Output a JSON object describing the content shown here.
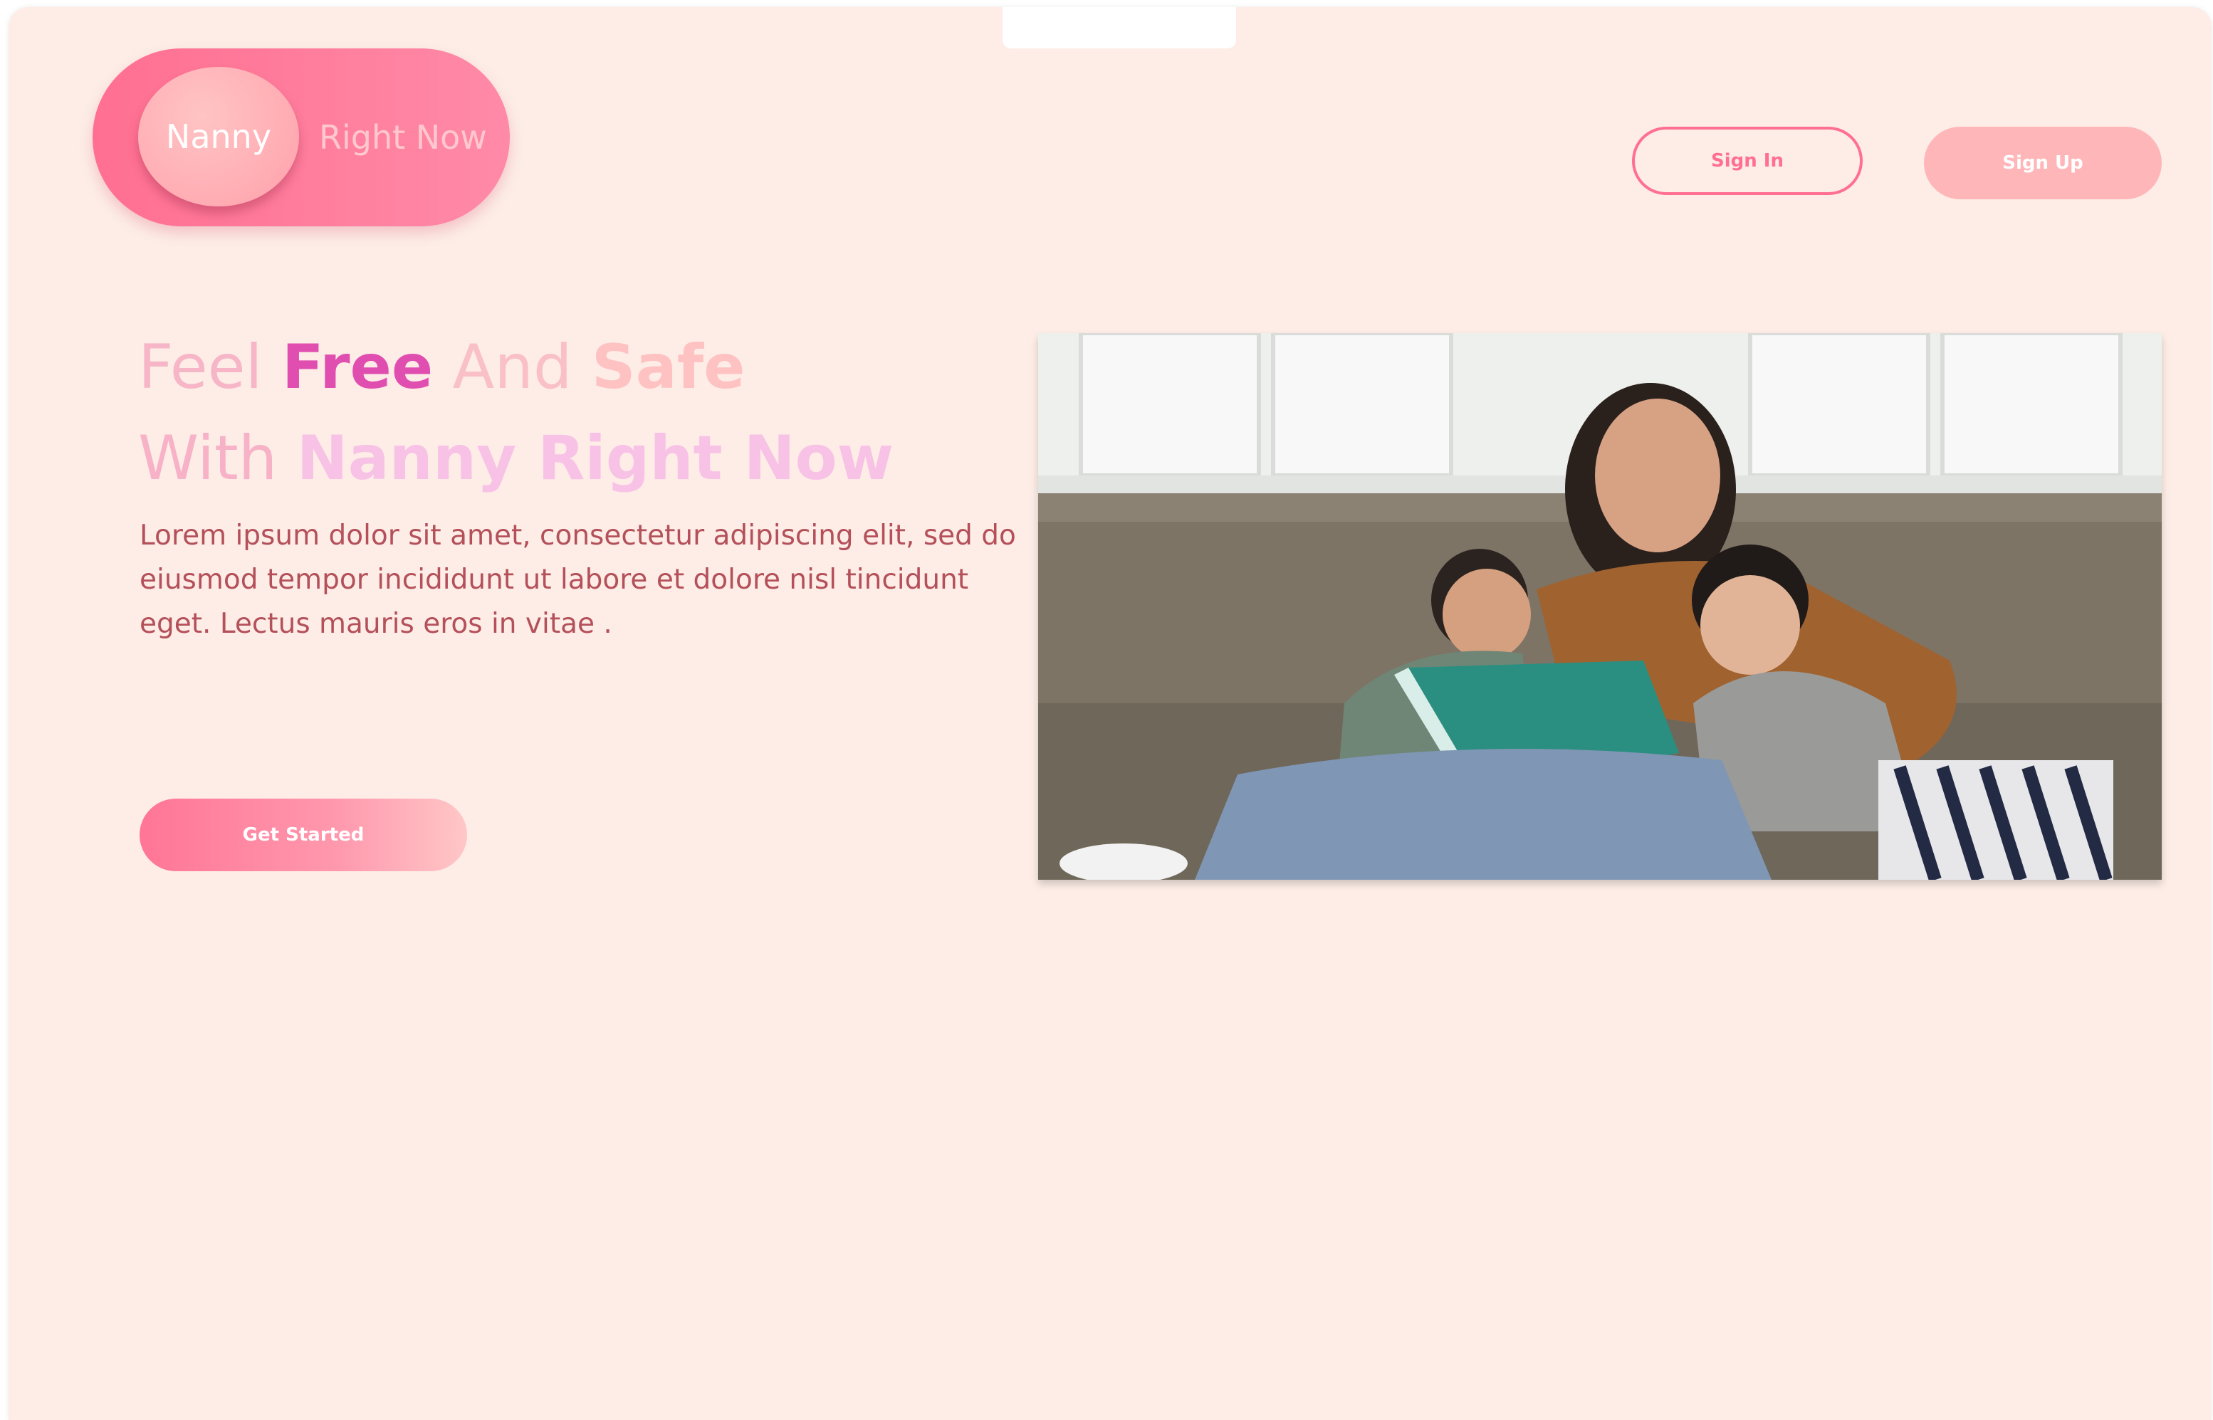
{
  "brand": {
    "name": "Nanny",
    "suffix": "Right Now"
  },
  "header": {
    "sign_in_label": "Sign In",
    "sign_up_label": "Sign Up"
  },
  "hero": {
    "headline_line1": [
      "Feel",
      "Free",
      "And",
      "Safe"
    ],
    "headline_line2": [
      "With",
      "Nanny Right Now"
    ],
    "lead": "Lorem ipsum dolor sit amet, consectetur adipiscing elit, sed do eiusmod tempor incididunt ut labore et dolore nisl tincidunt eget. Lectus mauris eros in vitae .",
    "cta_label": "Get Started",
    "image_alt": "Mother reading a book with two children on a sofa"
  },
  "colors": {
    "page_bg": "#fdede6",
    "primary": "#ff6f91",
    "secondary": "#ffb6b9",
    "body_text": "#b4505a",
    "accent_magenta": "#e04fb0"
  }
}
